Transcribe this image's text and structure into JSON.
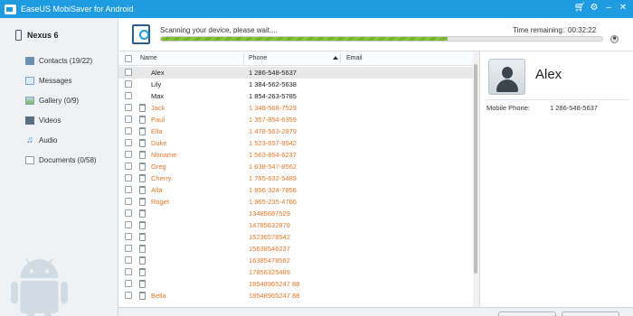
{
  "window": {
    "title": "EaseUS MobiSaver for Android",
    "controls": [
      "cart-icon",
      "settings-icon",
      "minimize-icon",
      "close-icon"
    ]
  },
  "sidebar": {
    "device": "Nexus 6",
    "items": [
      {
        "label": "Contacts (19/22)",
        "icon": "contacts-icon"
      },
      {
        "label": "Messages",
        "icon": "messages-icon"
      },
      {
        "label": "Gallery (0/9)",
        "icon": "gallery-icon"
      },
      {
        "label": "Videos",
        "icon": "videos-icon"
      },
      {
        "label": "Audio",
        "icon": "audio-icon"
      },
      {
        "label": "Documents (0/58)",
        "icon": "documents-icon"
      }
    ]
  },
  "scan": {
    "status": "Scanning your device, please wait....",
    "time_label": "Time remaining:",
    "time_value": "00:32:22",
    "progress": 0.65
  },
  "list": {
    "columns": {
      "name": "Name",
      "phone": "Phone",
      "email": "Email"
    },
    "rows": [
      {
        "name": "Alex",
        "phone": "1 286-548-5637",
        "deleted": false,
        "selected": true
      },
      {
        "name": "Lily",
        "phone": "1 384-562-5638",
        "deleted": false
      },
      {
        "name": "Max",
        "phone": "1 854-263-5785",
        "deleted": false
      },
      {
        "name": "Jack",
        "phone": "1 348-568-7529",
        "deleted": true
      },
      {
        "name": "Paul",
        "phone": "1 357-854-6359",
        "deleted": true
      },
      {
        "name": "Ella",
        "phone": "1 478-563-2879",
        "deleted": true
      },
      {
        "name": "Duke",
        "phone": "1 523-657-8542",
        "deleted": true
      },
      {
        "name": "Noname",
        "phone": "1 563-854-6237",
        "deleted": true
      },
      {
        "name": "Greg",
        "phone": "1 638-547-8562",
        "deleted": true
      },
      {
        "name": "Cherry",
        "phone": "1 785-632-5489",
        "deleted": true
      },
      {
        "name": "Alla",
        "phone": "1 856-324-7856",
        "deleted": true
      },
      {
        "name": "Roget",
        "phone": "1 965-235-4786",
        "deleted": true
      },
      {
        "name": "",
        "phone": "13485687529",
        "deleted": true
      },
      {
        "name": "",
        "phone": "14785632879",
        "deleted": true
      },
      {
        "name": "",
        "phone": "15236578542",
        "deleted": true
      },
      {
        "name": "",
        "phone": "15638546237",
        "deleted": true
      },
      {
        "name": "",
        "phone": "16385478562",
        "deleted": true
      },
      {
        "name": "",
        "phone": "17856325489",
        "deleted": true
      },
      {
        "name": "",
        "phone": "18548965247 88",
        "deleted": true
      },
      {
        "name": "Bella",
        "phone": "18548965247 88",
        "deleted": true
      }
    ]
  },
  "detail": {
    "name": "Alex",
    "field_label": "Mobile Phone:",
    "field_value": "1 286-548-5637"
  },
  "colors": {
    "titlebar": "#1f9be0",
    "deleted_text": "#e8782a",
    "progress": "#8ac43f"
  }
}
